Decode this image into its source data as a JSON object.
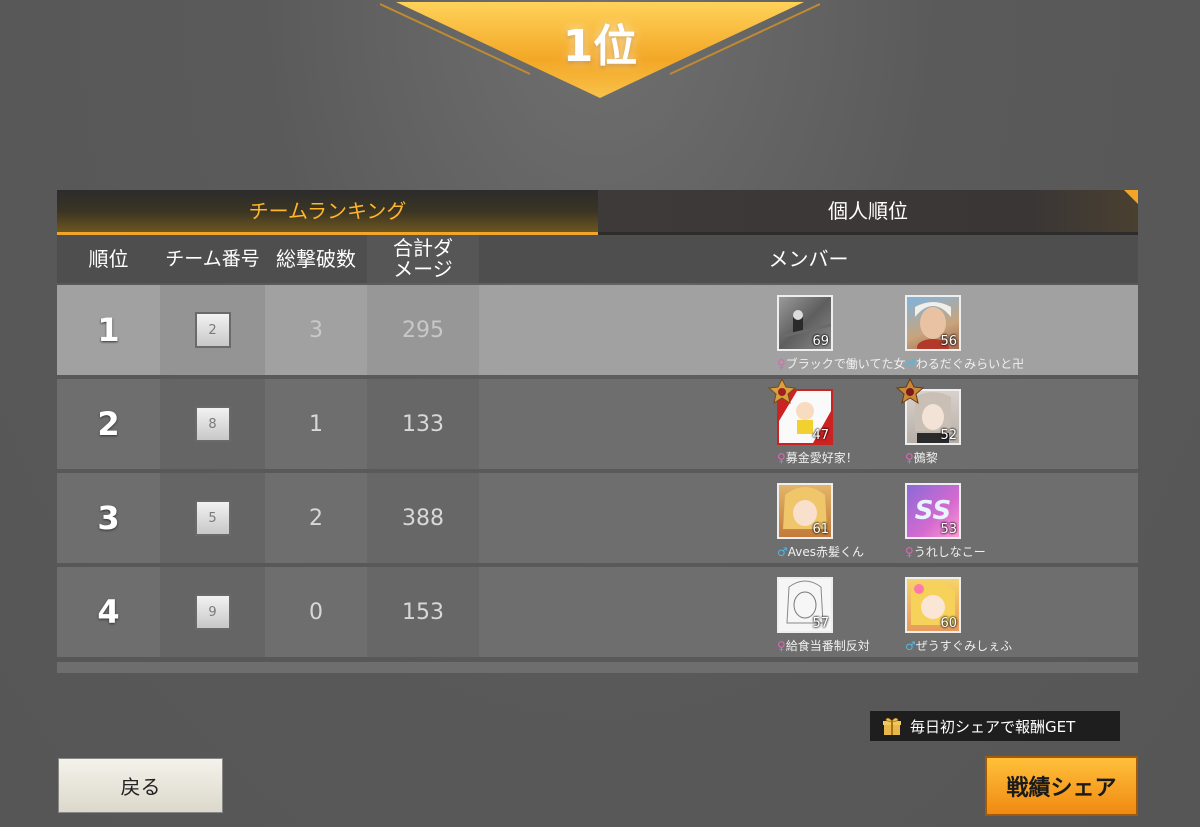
{
  "result": {
    "rank_label": "1位"
  },
  "tabs": {
    "team_ranking": "チームランキング",
    "personal_ranking": "個人順位"
  },
  "table": {
    "headers": {
      "rank": "順位",
      "team_number": "チーム番号",
      "total_kills": "総撃破数",
      "total_damage": "合計ダメージ",
      "members": "メンバー"
    },
    "rows": [
      {
        "rank": "1",
        "team_number": "2",
        "kills": "3",
        "damage": "295",
        "members": [
          {
            "gender": "♀",
            "name": "ブラックで働いてた女",
            "level": "69"
          },
          {
            "gender": "♂",
            "name": "わるだぐみらいと卍",
            "level": "56"
          }
        ]
      },
      {
        "rank": "2",
        "team_number": "8",
        "kills": "1",
        "damage": "133",
        "members": [
          {
            "gender": "♀",
            "name": "募金愛好家！",
            "level": "47"
          },
          {
            "gender": "♀",
            "name": "鵺黎",
            "level": "52"
          }
        ]
      },
      {
        "rank": "3",
        "team_number": "5",
        "kills": "2",
        "damage": "388",
        "members": [
          {
            "gender": "♂",
            "name": "Aves赤髪くん",
            "level": "61"
          },
          {
            "gender": "♀",
            "name": "うれしなこー",
            "level": "53"
          }
        ]
      },
      {
        "rank": "4",
        "team_number": "9",
        "kills": "0",
        "damage": "153",
        "members": [
          {
            "gender": "♀",
            "name": "給食当番制反対",
            "level": "57"
          },
          {
            "gender": "♂",
            "name": "ぜうすぐみしぇふ",
            "level": "60"
          }
        ]
      }
    ]
  },
  "footer": {
    "back_label": "戻る",
    "share_tip": "毎日初シェアで報酬GET",
    "share_label": "戦績シェア"
  },
  "colors": {
    "accent": "#f1a62a",
    "share_button": "#f5a623",
    "female": "#e85fbd",
    "male": "#4fb8e8"
  }
}
